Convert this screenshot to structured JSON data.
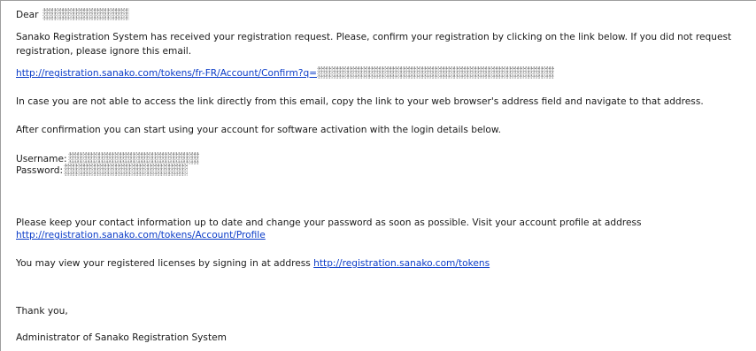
{
  "email": {
    "greeting": "Dear",
    "intro": "Sanako Registration System has received your registration request. Please, confirm your registration by clicking on the link below. If you did not request registration, please ignore this email.",
    "confirm_link_text": "http://registration.sanako.com/tokens/fr-FR/Account/Confirm?q=",
    "copy_instructions": "In case you are not able to access the link directly from this email, copy the link to your web browser's address field and navigate to that address.",
    "after_confirmation": "After confirmation you can start using your account for software activation with the login details below.",
    "username_label": "Username:",
    "password_label": "Password:",
    "keep_info": "Please keep your contact information up to date and change your password as soon as possible. Visit your account profile at address",
    "profile_link_text": "http://registration.sanako.com/tokens/Account/Profile",
    "licenses_text": "You may view your registered licenses by signing in at address",
    "tokens_link_text": "http://registration.sanako.com/tokens",
    "thanks": "Thank you,",
    "signature": "Administrator of Sanako Registration System"
  }
}
